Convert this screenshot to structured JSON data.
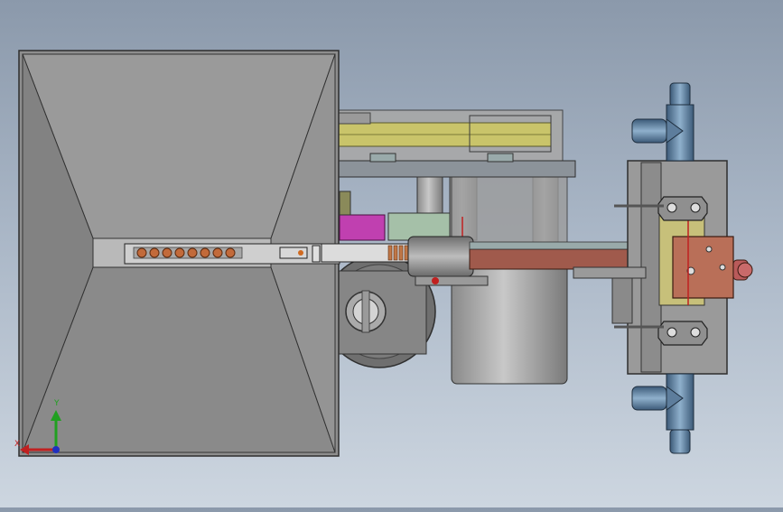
{
  "viewport": {
    "description_free": true,
    "colors": {
      "background_top": "#8b99ab",
      "background_bottom": "#cdd6e0",
      "hopper_face": "#8e8e8e",
      "hopper_edge": "#3a3a3a",
      "belt": "#c9c46a",
      "housing": "#9a9a9a",
      "push_rod": "#a05a4c",
      "connector": "#4a6f8e",
      "accent_magenta": "#c040b0",
      "bracket_orange": "#b07050"
    },
    "axis_triad": {
      "x_label": "X",
      "y_label": "Y",
      "x_color": "#c02020",
      "y_color": "#20a020",
      "z_color": "#2030c0"
    }
  }
}
